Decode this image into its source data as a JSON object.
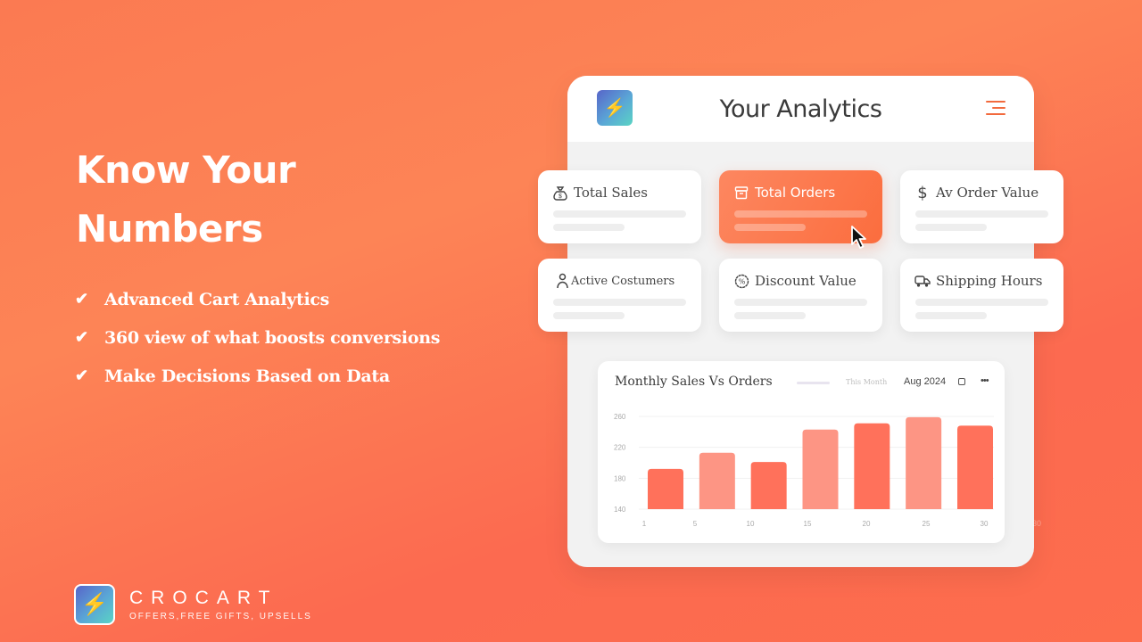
{
  "hero": {
    "title_line1": "Know Your",
    "title_line2": "Numbers",
    "features": [
      {
        "icon": "check-icon",
        "text": "Advanced Cart Analytics"
      },
      {
        "icon": "check-icon",
        "text": "360 view of what boosts conversions"
      },
      {
        "icon": "check-icon",
        "text": "Make Decisions Based on Data"
      }
    ]
  },
  "brand": {
    "name": "CROCART",
    "tagline": "OFFERS,FREE GIFTS, UPSELLS",
    "logo_icon": "raised-fist-lightning-logo"
  },
  "panel": {
    "title": "Your Analytics",
    "menu_icon": "menu-icon",
    "cards": [
      {
        "label": "Total Sales",
        "icon": "money-bag-icon",
        "active": false
      },
      {
        "label": "Total Orders",
        "icon": "archive-box-icon",
        "active": true
      },
      {
        "label": "Av Order Value",
        "icon": "dollar-icon",
        "active": false
      },
      {
        "label": "Active Costumers",
        "icon": "user-icon",
        "active": false
      },
      {
        "label": "Discount Value",
        "icon": "discount-badge-icon",
        "active": false
      },
      {
        "label": "Shipping Hours",
        "icon": "truck-icon",
        "active": false
      }
    ]
  },
  "colors": {
    "accent": "#fb6d3e",
    "bar_dark": "#ff715b",
    "bar_light": "#fd9584",
    "menu": "#f26a3d"
  },
  "chart_data": {
    "type": "bar",
    "title": "Monthly Sales Vs Orders",
    "legend": [
      {
        "name": "This Month"
      }
    ],
    "legend_position": "top-right",
    "period": "Aug 2024",
    "x": [
      "1",
      "5",
      "10",
      "15",
      "20",
      "25",
      "30"
    ],
    "x_ticks": [
      "1",
      "5",
      "10",
      "15",
      "20",
      "25",
      "30"
    ],
    "y_ticks": [
      140,
      180,
      220,
      260
    ],
    "ylim": [
      140,
      260
    ],
    "grid": true,
    "series": [
      {
        "name": "Monthly Sales Vs Orders",
        "values": [
          192,
          213,
          201,
          243,
          251,
          259,
          248
        ],
        "shade": [
          "dark",
          "light",
          "dark",
          "light",
          "dark",
          "light",
          "dark"
        ]
      }
    ],
    "xlabel": "",
    "ylabel": ""
  },
  "ghost_label": "30"
}
